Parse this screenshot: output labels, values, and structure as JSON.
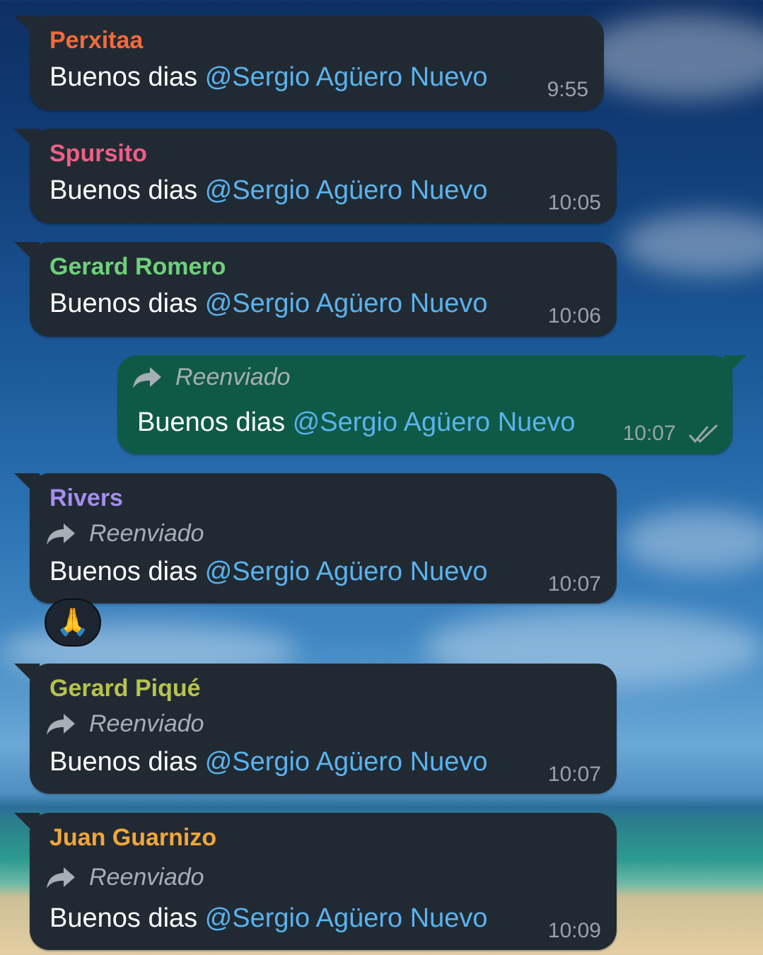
{
  "messages": [
    {
      "sender": "Perxitaa",
      "sender_color": "#f36a3c",
      "forwarded": false,
      "text": "Buenos dias ",
      "mention": "@Sergio Agüero Nuevo",
      "time": "9:55"
    },
    {
      "sender": "Spursito",
      "sender_color": "#ef5f86",
      "forwarded": false,
      "text": "Buenos dias ",
      "mention": "@Sergio Agüero Nuevo",
      "time": "10:05"
    },
    {
      "sender": "Gerard Romero",
      "sender_color": "#6ed17a",
      "forwarded": false,
      "text": "Buenos dias ",
      "mention": "@Sergio Agüero Nuevo",
      "time": "10:06"
    },
    {
      "sender": "",
      "forwarded": true,
      "forward_label": "Reenviado",
      "text": "Buenos dias ",
      "mention": "@Sergio Agüero Nuevo",
      "time": "10:07",
      "outgoing": true,
      "status_icon": "double-check-icon"
    },
    {
      "sender": "Rivers",
      "sender_color": "#a58df0",
      "forwarded": true,
      "forward_label": "Reenviado",
      "text": "Buenos dias ",
      "mention": "@Sergio Agüero Nuevo",
      "time": "10:07",
      "reaction": "🙏"
    },
    {
      "sender": "Gerard Piqué",
      "sender_color": "#b8c24e",
      "forwarded": true,
      "forward_label": "Reenviado",
      "text": "Buenos dias ",
      "mention": "@Sergio Agüero Nuevo",
      "time": "10:07"
    },
    {
      "sender": "Juan Guarnizo",
      "sender_color": "#f2a63a",
      "forwarded": true,
      "forward_label": "Reenviado",
      "text": "Buenos dias ",
      "mention": "@Sergio Agüero Nuevo",
      "time": "10:09"
    }
  ],
  "colors": {
    "incoming_bubble": "#212a33",
    "outgoing_bubble": "#0f5a46",
    "mention": "#5ab3ee",
    "time": "#9aa3ab"
  }
}
